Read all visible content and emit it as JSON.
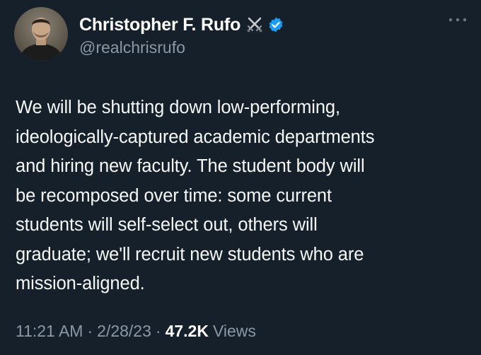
{
  "tweet": {
    "author": {
      "display_name": "Christopher F. Rufo",
      "handle": "@realchrisrufo",
      "name_emoji_icon": "crossed-swords-icon",
      "verified_icon": "verified-badge-icon"
    },
    "more_icon": "ellipsis-icon",
    "text": "We will be shutting down low-performing,\nideologically-captured academic departments\nand hiring new faculty. The student body will\nbe recomposed over time: some current\nstudents will self-select out, others will\ngraduate; we'll recruit new students who are\nmission-aligned.",
    "time": "11:21 AM",
    "date": "2/28/23",
    "separator": "·",
    "views_count": "47.2K",
    "views_label": "Views"
  },
  "colors": {
    "background": "#15202b",
    "text": "#f7f9f9",
    "secondary_text": "#8b98a5",
    "verified_blue": "#1d9bf0"
  }
}
